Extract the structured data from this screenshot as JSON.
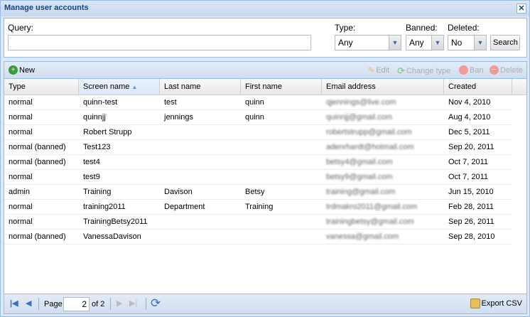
{
  "window": {
    "title": "Manage user accounts"
  },
  "form": {
    "query_label": "Query:",
    "query_value": "",
    "type_label": "Type:",
    "type_value": "Any",
    "banned_label": "Banned:",
    "banned_value": "Any",
    "deleted_label": "Deleted:",
    "deleted_value": "No",
    "search_label": "Search"
  },
  "toolbar": {
    "new": "New",
    "edit": "Edit",
    "change_type": "Change type",
    "ban": "Ban",
    "delete": "Delete"
  },
  "columns": [
    "Type",
    "Screen name",
    "Last name",
    "First name",
    "Email address",
    "Created"
  ],
  "sort": {
    "column": "Screen name",
    "direction": "ascending"
  },
  "rows": [
    [
      "normal",
      "quinn-test",
      "test",
      "quinn",
      "qjennings@live.com",
      "Nov 4, 2010"
    ],
    [
      "normal",
      "quinnjj",
      "jennings",
      "quinn",
      "quinnjj@gmail.com",
      "Aug 4, 2010"
    ],
    [
      "normal",
      "Robert Strupp",
      "",
      "",
      "robertstrupp@gmail.com",
      "Dec 5, 2011"
    ],
    [
      "normal (banned)",
      "Test123",
      "",
      "",
      "adenrhardt@hotmail.com",
      "Sep 20, 2011"
    ],
    [
      "normal (banned)",
      "test4",
      "",
      "",
      "betsy4@gmail.com",
      "Oct 7, 2011"
    ],
    [
      "normal",
      "test9",
      "",
      "",
      "betsy9@gmail.com",
      "Oct 7, 2011"
    ],
    [
      "admin",
      "Training",
      "Davison",
      "Betsy",
      "training@gmail.com",
      "Jun 15, 2010"
    ],
    [
      "normal",
      "training2011",
      "Department",
      "Training",
      "trdmakro2011@gmail.com",
      "Feb 28, 2011"
    ],
    [
      "normal",
      "TrainingBetsy2011",
      "",
      "",
      "trainingbetsy@gmail.com",
      "Sep 26, 2011"
    ],
    [
      "normal (banned)",
      "VanessaDavison",
      "",
      "",
      "vanessa@gmail.com",
      "Sep 28, 2010"
    ]
  ],
  "pager": {
    "page_label": "Page",
    "page_value": "2",
    "of_label": "of 2",
    "export": "Export CSV"
  }
}
